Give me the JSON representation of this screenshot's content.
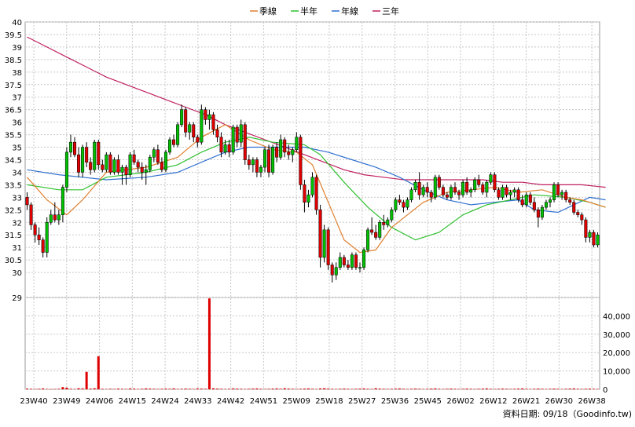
{
  "chart_data": {
    "type": "candlestick",
    "legend": {
      "placement": "top-center",
      "items": [
        {
          "name": "季線",
          "color": "#e08030"
        },
        {
          "name": "半年",
          "color": "#30c030"
        },
        {
          "name": "年線",
          "color": "#3070d0"
        },
        {
          "name": "三年",
          "color": "#c02060"
        }
      ]
    },
    "price_axis": {
      "side": "left",
      "ylim": [
        29,
        40
      ],
      "ticks": [
        "40",
        "39.5",
        "39",
        "38.5",
        "38",
        "37.5",
        "37",
        "36.5",
        "36",
        "35.5",
        "35",
        "34.5",
        "34",
        "33.5",
        "33",
        "32.5",
        "32",
        "31.5",
        "31",
        "30.5",
        "30",
        "29"
      ]
    },
    "volume_axis": {
      "side": "right",
      "ylim": [
        0,
        50000
      ],
      "ticks": [
        "40,000",
        "30,000",
        "20,000",
        "10,000",
        "0"
      ]
    },
    "x_axis": {
      "labels": [
        "23W40",
        "23W49",
        "24W06",
        "24W15",
        "24W24",
        "24W33",
        "24W42",
        "24W51",
        "25W09",
        "25W18",
        "25W27",
        "25W36",
        "25W45",
        "26W02",
        "26W12",
        "26W21",
        "26W30",
        "26W38"
      ]
    },
    "grid": true,
    "up_color": "#00c000",
    "down_color": "#e00000",
    "volume_color": "#e00000",
    "candles": [
      [
        33.0,
        33.2,
        32.5,
        32.7
      ],
      [
        32.7,
        32.8,
        31.7,
        31.9
      ],
      [
        31.9,
        32.0,
        31.2,
        31.5
      ],
      [
        31.5,
        31.8,
        31.1,
        31.3
      ],
      [
        31.3,
        31.4,
        30.6,
        30.8
      ],
      [
        30.8,
        32.2,
        30.6,
        32.0
      ],
      [
        32.0,
        32.5,
        31.9,
        32.3
      ],
      [
        32.3,
        32.8,
        32.0,
        32.1
      ],
      [
        32.1,
        32.5,
        31.9,
        32.3
      ],
      [
        32.3,
        33.5,
        32.0,
        33.4
      ],
      [
        33.4,
        35.0,
        33.2,
        34.8
      ],
      [
        34.8,
        35.5,
        34.6,
        35.2
      ],
      [
        35.2,
        35.4,
        34.6,
        34.7
      ],
      [
        34.7,
        35.0,
        33.8,
        34.0
      ],
      [
        34.0,
        35.1,
        33.8,
        35.0
      ],
      [
        35.0,
        35.2,
        34.2,
        34.4
      ],
      [
        34.4,
        34.6,
        33.9,
        34.1
      ],
      [
        34.1,
        35.3,
        34.0,
        35.2
      ],
      [
        35.2,
        35.3,
        34.1,
        34.3
      ],
      [
        34.3,
        34.5,
        34.0,
        34.1
      ],
      [
        34.1,
        34.8,
        34.0,
        34.7
      ],
      [
        34.7,
        34.8,
        33.9,
        34.0
      ],
      [
        34.0,
        34.6,
        33.9,
        34.5
      ],
      [
        34.5,
        34.7,
        33.9,
        34.0
      ],
      [
        34.0,
        34.3,
        33.5,
        34.2
      ],
      [
        34.2,
        34.3,
        33.5,
        33.9
      ],
      [
        33.9,
        34.8,
        33.8,
        34.7
      ],
      [
        34.7,
        34.9,
        34.3,
        34.4
      ],
      [
        34.4,
        34.5,
        34.0,
        34.2
      ],
      [
        34.2,
        34.4,
        33.7,
        34.0
      ],
      [
        34.0,
        34.3,
        33.5,
        34.1
      ],
      [
        34.1,
        34.7,
        34.0,
        34.6
      ],
      [
        34.6,
        35.0,
        34.4,
        34.9
      ],
      [
        34.9,
        35.1,
        34.3,
        34.4
      ],
      [
        34.4,
        34.6,
        34.0,
        34.1
      ],
      [
        34.1,
        34.9,
        34.0,
        34.8
      ],
      [
        34.8,
        35.4,
        34.7,
        35.3
      ],
      [
        35.3,
        35.5,
        35.0,
        35.1
      ],
      [
        35.1,
        36.0,
        35.0,
        35.9
      ],
      [
        35.9,
        36.7,
        35.8,
        36.5
      ],
      [
        36.5,
        36.6,
        35.4,
        35.6
      ],
      [
        35.6,
        36.0,
        35.3,
        35.9
      ],
      [
        35.9,
        36.0,
        35.2,
        35.4
      ],
      [
        35.4,
        35.5,
        35.0,
        35.2
      ],
      [
        35.2,
        36.7,
        35.1,
        36.5
      ],
      [
        36.5,
        36.6,
        35.9,
        36.1
      ],
      [
        36.1,
        36.5,
        35.7,
        36.3
      ],
      [
        36.3,
        36.4,
        35.5,
        35.7
      ],
      [
        35.7,
        35.9,
        35.2,
        35.4
      ],
      [
        35.4,
        35.6,
        34.6,
        34.8
      ],
      [
        34.8,
        35.3,
        34.7,
        35.1
      ],
      [
        35.1,
        35.3,
        34.6,
        34.8
      ],
      [
        34.8,
        35.9,
        34.7,
        35.8
      ],
      [
        35.8,
        35.9,
        35.0,
        35.2
      ],
      [
        35.2,
        36.1,
        35.0,
        35.9
      ],
      [
        35.9,
        36.0,
        34.3,
        34.5
      ],
      [
        34.5,
        34.7,
        34.1,
        34.3
      ],
      [
        34.3,
        34.6,
        34.0,
        34.5
      ],
      [
        34.5,
        34.6,
        33.8,
        34.0
      ],
      [
        34.0,
        34.3,
        33.8,
        34.2
      ],
      [
        34.2,
        35.0,
        34.0,
        34.9
      ],
      [
        34.9,
        35.1,
        33.8,
        34.0
      ],
      [
        34.0,
        35.1,
        33.9,
        35.0
      ],
      [
        35.0,
        35.2,
        34.4,
        34.6
      ],
      [
        34.6,
        35.5,
        34.5,
        35.3
      ],
      [
        35.3,
        35.4,
        34.6,
        34.8
      ],
      [
        34.8,
        35.1,
        34.5,
        34.7
      ],
      [
        34.7,
        35.0,
        34.4,
        34.9
      ],
      [
        34.9,
        35.6,
        34.8,
        35.4
      ],
      [
        35.4,
        35.5,
        33.3,
        33.5
      ],
      [
        33.5,
        33.7,
        32.4,
        32.8
      ],
      [
        32.8,
        33.3,
        32.6,
        33.1
      ],
      [
        33.1,
        34.0,
        33.0,
        33.8
      ],
      [
        33.8,
        33.9,
        32.3,
        32.5
      ],
      [
        32.5,
        32.7,
        30.2,
        30.6
      ],
      [
        30.6,
        31.9,
        30.4,
        31.7
      ],
      [
        31.7,
        31.8,
        30.1,
        30.3
      ],
      [
        30.3,
        30.4,
        29.6,
        29.9
      ],
      [
        29.9,
        30.4,
        29.7,
        30.2
      ],
      [
        30.2,
        30.8,
        30.1,
        30.6
      ],
      [
        30.6,
        30.7,
        30.2,
        30.3
      ],
      [
        30.3,
        30.5,
        30.1,
        30.2
      ],
      [
        30.2,
        30.8,
        30.1,
        30.7
      ],
      [
        30.7,
        30.8,
        30.1,
        30.2
      ],
      [
        30.2,
        30.4,
        30.0,
        30.2
      ],
      [
        30.2,
        31.0,
        30.1,
        30.9
      ],
      [
        30.9,
        31.8,
        30.8,
        31.7
      ],
      [
        31.7,
        32.2,
        31.5,
        31.6
      ],
      [
        31.6,
        31.9,
        31.3,
        31.4
      ],
      [
        31.4,
        32.1,
        31.3,
        32.0
      ],
      [
        32.0,
        32.3,
        31.7,
        31.9
      ],
      [
        31.9,
        32.2,
        31.8,
        32.1
      ],
      [
        32.1,
        32.6,
        32.0,
        32.5
      ],
      [
        32.5,
        33.0,
        32.4,
        32.9
      ],
      [
        32.9,
        33.1,
        32.7,
        32.8
      ],
      [
        32.8,
        32.9,
        32.4,
        32.6
      ],
      [
        32.6,
        33.0,
        32.5,
        32.9
      ],
      [
        32.9,
        33.4,
        32.8,
        33.3
      ],
      [
        33.3,
        33.7,
        33.2,
        33.6
      ],
      [
        33.6,
        34.0,
        32.9,
        33.1
      ],
      [
        33.1,
        33.5,
        33.0,
        33.4
      ],
      [
        33.4,
        33.6,
        33.0,
        33.2
      ],
      [
        33.2,
        33.3,
        32.8,
        33.0
      ],
      [
        33.0,
        33.9,
        32.9,
        33.8
      ],
      [
        33.8,
        33.9,
        33.3,
        33.4
      ],
      [
        33.4,
        33.5,
        33.0,
        33.1
      ],
      [
        33.1,
        33.2,
        32.9,
        33.0
      ],
      [
        33.0,
        33.5,
        32.9,
        33.4
      ],
      [
        33.4,
        33.6,
        33.1,
        33.2
      ],
      [
        33.2,
        33.3,
        32.9,
        33.1
      ],
      [
        33.1,
        33.7,
        33.0,
        33.6
      ],
      [
        33.6,
        33.8,
        33.1,
        33.2
      ],
      [
        33.2,
        33.4,
        33.0,
        33.3
      ],
      [
        33.3,
        33.8,
        33.2,
        33.7
      ],
      [
        33.7,
        33.9,
        33.4,
        33.5
      ],
      [
        33.5,
        33.6,
        33.1,
        33.2
      ],
      [
        33.2,
        33.7,
        33.0,
        33.6
      ],
      [
        33.6,
        34.0,
        33.5,
        33.9
      ],
      [
        33.9,
        34.0,
        33.2,
        33.3
      ],
      [
        33.3,
        33.4,
        32.9,
        33.0
      ],
      [
        33.0,
        33.5,
        32.9,
        33.4
      ],
      [
        33.4,
        33.5,
        33.0,
        33.1
      ],
      [
        33.1,
        33.3,
        32.9,
        33.2
      ],
      [
        33.2,
        33.4,
        33.0,
        33.3
      ],
      [
        33.3,
        33.4,
        32.8,
        32.9
      ],
      [
        32.9,
        33.1,
        32.6,
        32.7
      ],
      [
        32.7,
        33.2,
        32.6,
        33.1
      ],
      [
        33.1,
        33.2,
        32.7,
        32.8
      ],
      [
        32.8,
        33.0,
        32.4,
        32.5
      ],
      [
        32.5,
        32.6,
        31.8,
        32.2
      ],
      [
        32.2,
        32.7,
        32.1,
        32.6
      ],
      [
        32.6,
        32.9,
        32.5,
        32.8
      ],
      [
        32.8,
        33.0,
        32.6,
        32.9
      ],
      [
        32.9,
        33.6,
        32.8,
        33.5
      ],
      [
        33.5,
        33.6,
        33.0,
        33.1
      ],
      [
        33.1,
        33.3,
        32.9,
        33.2
      ],
      [
        33.2,
        33.3,
        32.8,
        32.9
      ],
      [
        32.9,
        33.0,
        32.7,
        32.8
      ],
      [
        32.8,
        32.9,
        32.3,
        32.4
      ],
      [
        32.4,
        32.5,
        32.2,
        32.3
      ],
      [
        32.3,
        32.4,
        31.9,
        32.1
      ],
      [
        32.1,
        32.2,
        31.2,
        31.4
      ],
      [
        31.4,
        31.7,
        31.2,
        31.6
      ],
      [
        31.6,
        31.7,
        31.0,
        31.1
      ],
      [
        31.1,
        31.6,
        31.0,
        31.5
      ]
    ],
    "ma_quarter": [
      [
        0,
        33.8
      ],
      [
        5,
        32.9
      ],
      [
        10,
        32.3
      ],
      [
        14,
        32.9
      ],
      [
        20,
        34.0
      ],
      [
        30,
        34.2
      ],
      [
        38,
        34.6
      ],
      [
        44,
        35.4
      ],
      [
        50,
        35.9
      ],
      [
        56,
        35.3
      ],
      [
        62,
        34.9
      ],
      [
        68,
        34.8
      ],
      [
        72,
        34.3
      ],
      [
        76,
        32.8
      ],
      [
        80,
        31.3
      ],
      [
        84,
        30.8
      ],
      [
        88,
        30.9
      ],
      [
        92,
        31.8
      ],
      [
        96,
        32.3
      ],
      [
        100,
        32.8
      ],
      [
        106,
        33.2
      ],
      [
        112,
        33.3
      ],
      [
        118,
        33.4
      ],
      [
        124,
        33.2
      ],
      [
        130,
        33.3
      ],
      [
        136,
        33.0
      ],
      [
        140,
        32.9
      ],
      [
        146,
        32.6
      ]
    ],
    "ma_half": [
      [
        0,
        33.5
      ],
      [
        8,
        33.3
      ],
      [
        14,
        33.3
      ],
      [
        20,
        33.8
      ],
      [
        30,
        34.0
      ],
      [
        38,
        34.3
      ],
      [
        44,
        34.8
      ],
      [
        50,
        35.2
      ],
      [
        56,
        35.4
      ],
      [
        62,
        35.2
      ],
      [
        70,
        35.1
      ],
      [
        74,
        34.7
      ],
      [
        80,
        33.6
      ],
      [
        86,
        32.6
      ],
      [
        92,
        31.8
      ],
      [
        98,
        31.3
      ],
      [
        104,
        31.6
      ],
      [
        110,
        32.3
      ],
      [
        116,
        32.7
      ],
      [
        122,
        32.9
      ],
      [
        128,
        33.1
      ],
      [
        136,
        33.0
      ],
      [
        142,
        32.8
      ],
      [
        146,
        32.6
      ]
    ],
    "ma_year": [
      [
        0,
        34.1
      ],
      [
        8,
        33.9
      ],
      [
        14,
        33.8
      ],
      [
        20,
        33.7
      ],
      [
        30,
        33.8
      ],
      [
        38,
        34.0
      ],
      [
        44,
        34.4
      ],
      [
        50,
        34.8
      ],
      [
        56,
        35.0
      ],
      [
        62,
        35.0
      ],
      [
        70,
        35.0
      ],
      [
        76,
        34.8
      ],
      [
        82,
        34.5
      ],
      [
        88,
        34.2
      ],
      [
        94,
        33.8
      ],
      [
        100,
        33.3
      ],
      [
        106,
        32.9
      ],
      [
        112,
        32.7
      ],
      [
        118,
        32.8
      ],
      [
        124,
        32.9
      ],
      [
        128,
        32.5
      ],
      [
        134,
        32.4
      ],
      [
        138,
        32.7
      ],
      [
        142,
        33.0
      ],
      [
        146,
        32.9
      ]
    ],
    "ma_3year": [
      [
        0,
        39.4
      ],
      [
        5,
        39.0
      ],
      [
        10,
        38.6
      ],
      [
        15,
        38.2
      ],
      [
        20,
        37.8
      ],
      [
        25,
        37.5
      ],
      [
        30,
        37.2
      ],
      [
        35,
        36.9
      ],
      [
        40,
        36.6
      ],
      [
        45,
        36.3
      ],
      [
        50,
        35.9
      ],
      [
        55,
        35.6
      ],
      [
        60,
        35.3
      ],
      [
        65,
        35.0
      ],
      [
        70,
        34.7
      ],
      [
        75,
        34.4
      ],
      [
        80,
        34.1
      ],
      [
        85,
        33.9
      ],
      [
        90,
        33.8
      ],
      [
        95,
        33.7
      ],
      [
        100,
        33.7
      ],
      [
        105,
        33.7
      ],
      [
        110,
        33.7
      ],
      [
        115,
        33.7
      ],
      [
        120,
        33.6
      ],
      [
        125,
        33.6
      ],
      [
        130,
        33.5
      ],
      [
        135,
        33.5
      ],
      [
        140,
        33.5
      ],
      [
        146,
        33.4
      ]
    ],
    "volume": [
      400,
      300,
      200,
      300,
      500,
      200,
      100,
      200,
      300,
      1200,
      900,
      300,
      200,
      600,
      500,
      9500,
      400,
      600,
      18000,
      300,
      200,
      300,
      200,
      400,
      300,
      200,
      500,
      400,
      200,
      300,
      500,
      400,
      300,
      200,
      300,
      400,
      300,
      500,
      200,
      300,
      400,
      300,
      200,
      500,
      400,
      300,
      49500,
      600,
      400,
      300,
      200,
      300,
      500,
      400,
      300,
      200,
      300,
      400,
      500,
      300,
      200,
      300,
      400,
      500,
      300,
      600,
      400,
      300,
      200,
      300,
      400,
      500,
      300,
      200,
      500,
      600,
      400,
      300,
      200,
      300,
      400,
      300,
      200,
      300,
      400,
      500,
      300,
      200,
      600,
      400,
      300,
      200,
      300,
      400,
      500,
      300,
      200,
      300,
      400,
      300,
      200,
      300,
      400,
      500,
      300,
      200,
      300,
      400,
      300,
      200,
      300,
      400,
      300,
      200,
      300,
      400,
      500,
      300,
      200,
      300,
      400,
      300,
      200,
      300,
      400,
      500,
      300,
      200,
      300,
      400,
      300,
      200,
      300,
      400,
      300,
      200,
      300,
      400,
      500,
      300,
      200,
      300,
      400,
      300,
      200,
      300,
      400
    ],
    "source_note": "資料日期: 09/18（Goodinfo.tw)"
  }
}
